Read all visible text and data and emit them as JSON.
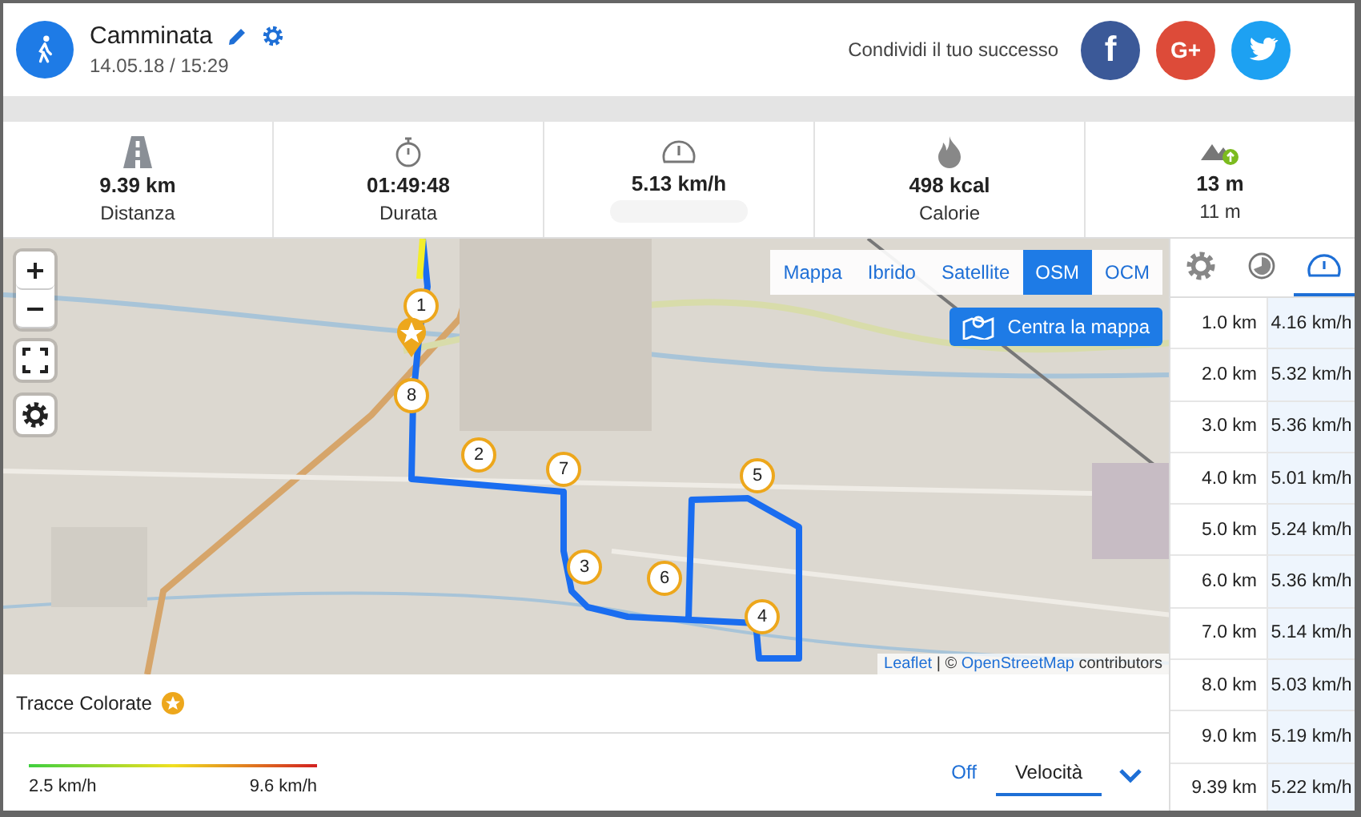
{
  "activity": {
    "title": "Camminata",
    "datetime": "14.05.18 / 15:29"
  },
  "share": {
    "label": "Condividi il tuo successo",
    "buttons": [
      {
        "kind": "facebook",
        "label": "f"
      },
      {
        "kind": "google",
        "label": "G+"
      },
      {
        "kind": "twitter"
      }
    ]
  },
  "stats": [
    {
      "kind": "distance",
      "value": "9.39 km",
      "label": "Distanza"
    },
    {
      "kind": "duration",
      "value": "01:49:48",
      "label": "Durata"
    },
    {
      "kind": "speed",
      "value": "5.13 km/h"
    },
    {
      "kind": "calories",
      "value": "498 kcal",
      "label": "Calorie"
    },
    {
      "kind": "elevation",
      "value": "13 m",
      "label": "11 m"
    }
  ],
  "map": {
    "layers": [
      {
        "label": "Mappa",
        "selected": false
      },
      {
        "label": "Ibrido",
        "selected": false
      },
      {
        "label": "Satellite",
        "selected": false
      },
      {
        "label": "OSM",
        "selected": true
      },
      {
        "label": "OCM",
        "selected": false
      }
    ],
    "center_button": "Centra la mappa",
    "markers": [
      "1",
      "8",
      "2",
      "7",
      "3",
      "6",
      "5",
      "4"
    ],
    "attribution": {
      "link1": "Leaflet",
      "sep": "| ©",
      "link2": "OpenStreetMap",
      "rest": "contributors"
    }
  },
  "splits": {
    "tabs": [
      {
        "kind": "settings",
        "selected": false
      },
      {
        "kind": "time",
        "selected": false
      },
      {
        "kind": "speed",
        "selected": true
      }
    ],
    "rows": [
      {
        "distance": "1.0 km",
        "speed": "4.16 km/h"
      },
      {
        "distance": "2.0 km",
        "speed": "5.32 km/h"
      },
      {
        "distance": "3.0 km",
        "speed": "5.36 km/h"
      },
      {
        "distance": "4.0 km",
        "speed": "5.01 km/h"
      },
      {
        "distance": "5.0 km",
        "speed": "5.24 km/h"
      },
      {
        "distance": "6.0 km",
        "speed": "5.36 km/h"
      },
      {
        "distance": "7.0 km",
        "speed": "5.14 km/h"
      },
      {
        "distance": "8.0 km",
        "speed": "5.03 km/h"
      },
      {
        "distance": "9.0 km",
        "speed": "5.19 km/h"
      },
      {
        "distance": "9.39 km",
        "speed": "5.22 km/h"
      }
    ]
  },
  "colored_tracks": {
    "title": "Tracce Colorate",
    "min": "2.5 km/h",
    "max": "9.6 km/h",
    "options": [
      {
        "label": "Off",
        "selected": false
      },
      {
        "label": "Velocità",
        "selected": true
      }
    ]
  }
}
